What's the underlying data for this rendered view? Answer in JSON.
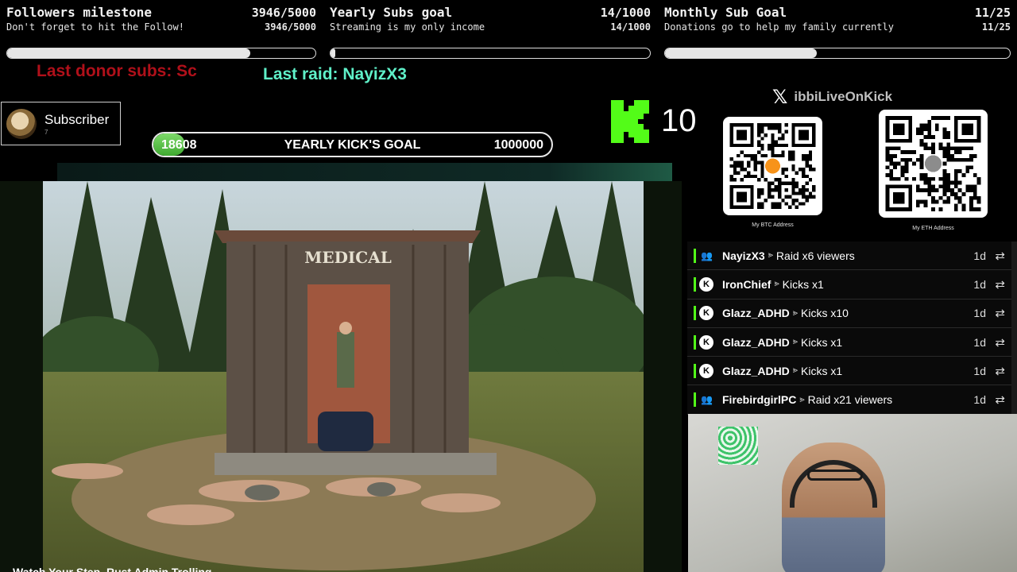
{
  "goals": {
    "followers": {
      "title": "Followers milestone",
      "count": "3946/5000",
      "subtitle": "Don't forget to hit the Follow!",
      "sub_count": "3946/5000",
      "progress": 0.789
    },
    "yearly_subs": {
      "title": "Yearly Subs goal",
      "count": "14/1000",
      "subtitle": "Streaming is my only income",
      "sub_count": "14/1000",
      "progress": 0.014
    },
    "monthly_sub": {
      "title": "Monthly Sub Goal",
      "count": "11/25",
      "subtitle": "Donations go to help my family currently",
      "sub_count": "11/25",
      "progress": 0.44
    }
  },
  "tickers": {
    "donor": "Last donor subs: Sc",
    "raid": "Last raid: NayizX3"
  },
  "subscriber_card": {
    "label": "Subscriber",
    "count": "7"
  },
  "kick_goal": {
    "current": "18608",
    "label": "YEARLY KICK'S GOAL",
    "target": "1000000",
    "progress": 0.0186
  },
  "kick_counter": {
    "value": "10",
    "brand_color": "#53fc18"
  },
  "social": {
    "icon": "x-logo-icon",
    "x_glyph": "𝕏",
    "handle": "ibbiLiveOnKick"
  },
  "qr_codes": {
    "btc": {
      "caption": "My BTC Address",
      "icon": "bitcoin-icon",
      "color": "#f7931a"
    },
    "eth": {
      "caption": "My ETH Address",
      "icon": "ethereum-icon",
      "color": "#8c8c8c"
    }
  },
  "game": {
    "sign_text": "MEDICAL",
    "caption": "Watch Your Step, Rust Admin Trolling"
  },
  "events": [
    {
      "type": "raid",
      "icon_text": "👥",
      "user": "NayizX3",
      "action": "Raid x6 viewers",
      "time": "1d",
      "arrow": "⪢",
      "repeat": "⇄"
    },
    {
      "type": "kick",
      "icon_text": "K",
      "user": "IronChief",
      "action": "Kicks x1",
      "time": "1d",
      "arrow": "⪢",
      "repeat": "⇄"
    },
    {
      "type": "kick",
      "icon_text": "K",
      "user": "Glazz_ADHD",
      "action": "Kicks x10",
      "time": "1d",
      "arrow": "⪢",
      "repeat": "⇄"
    },
    {
      "type": "kick",
      "icon_text": "K",
      "user": "Glazz_ADHD",
      "action": "Kicks x1",
      "time": "1d",
      "arrow": "⪢",
      "repeat": "⇄"
    },
    {
      "type": "kick",
      "icon_text": "K",
      "user": "Glazz_ADHD",
      "action": "Kicks x1",
      "time": "1d",
      "arrow": "⪢",
      "repeat": "⇄"
    },
    {
      "type": "raid",
      "icon_text": "👥",
      "user": "FirebirdgirlPC",
      "action": "Raid x21 viewers",
      "time": "1d",
      "arrow": "⪢",
      "repeat": "⇄"
    }
  ]
}
